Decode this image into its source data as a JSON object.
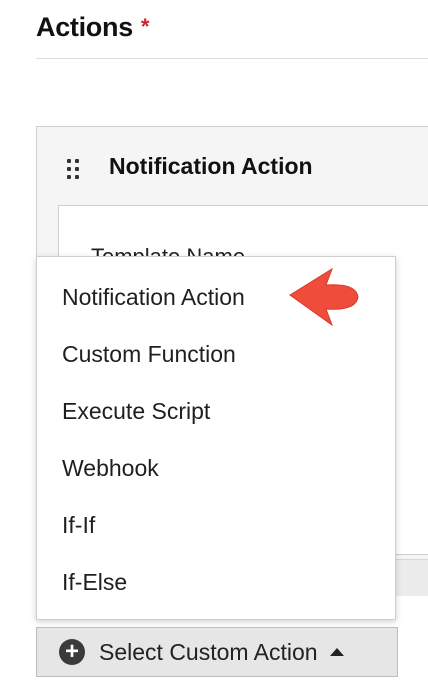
{
  "section": {
    "title": "Actions",
    "required_marker": "*"
  },
  "card": {
    "title": "Notification Action",
    "field_label": "Template Name"
  },
  "dropdown": {
    "items": [
      "Notification Action",
      "Custom Function",
      "Execute Script",
      "Webhook",
      "If-If",
      "If-Else"
    ]
  },
  "select_button": {
    "label": "Select Custom Action",
    "icon": "plus-circle-icon",
    "caret": "caret-up-icon"
  },
  "colors": {
    "required": "#d2232a",
    "pointer": "#f04c3b",
    "button_bg": "#e6e6e6"
  }
}
